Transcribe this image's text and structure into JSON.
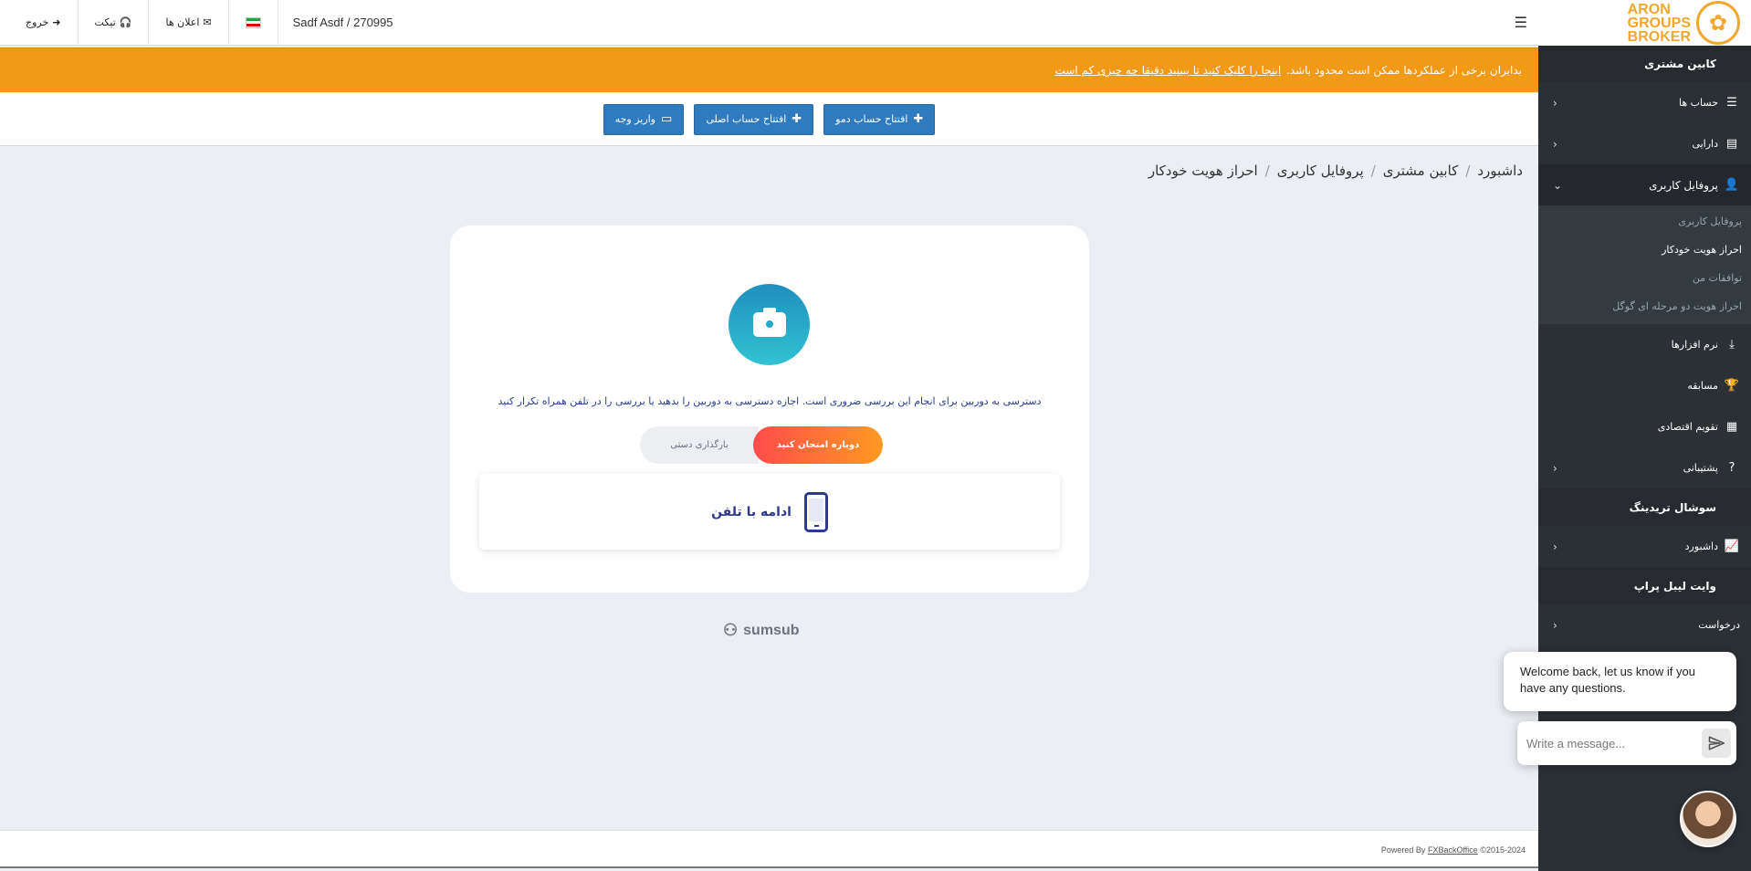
{
  "topbar": {
    "logout_label": "خروج",
    "ticket_label": "تیکت",
    "notifications_label": "اعلان ها",
    "user_label": "Sadf Asdf / 270995"
  },
  "warning": {
    "text": "بدایران برخی از عملکردها ممکن است محدود باشد.",
    "link_text": "اینجا را کلیک کنید تا ببینید دقیقا چه چیزی کم است"
  },
  "actions": {
    "demo_account": "افتتاح حساب دمو",
    "real_account": "افتتاح حساب اصلی",
    "deposit": "واریز وجه"
  },
  "breadcrumb": [
    "داشبورد",
    "کابین مشتری",
    "پروفایل کاربری",
    "احراز هویت خودکار"
  ],
  "verification": {
    "camera_message": "دسترسی به دوربین برای انجام این بررسی ضروری است. اجازه دسترسی به دوربین را بدهید یا بررسی را در تلفن همراه تکرار کنید",
    "retry_label": "دوباره امتحان کنید",
    "manual_upload_label": "بارگذاری دستی",
    "continue_phone_label": "ادامه با تلفن"
  },
  "sumsub_label": "sumsub",
  "footer": {
    "powered_prefix": "Powered By",
    "powered_link": "FXBackOffice",
    "copyright": "©2015-2024"
  },
  "sidebar": {
    "logo_lines": [
      "ARON",
      "GROUPS",
      "BROKER"
    ],
    "section_client": "کابین مشتری",
    "items": [
      {
        "label": "حساب ها",
        "icon": "list-icon"
      },
      {
        "label": "دارایی",
        "icon": "wallet-icon"
      },
      {
        "label": "پروفایل کاربری",
        "icon": "user-icon"
      }
    ],
    "profile_sub": [
      "پروفایل کاربری",
      "احراز هویت خودکار",
      "توافقات من",
      "احراز هویت دو مرحله ای گوگل"
    ],
    "items2": [
      {
        "label": "نرم افزارها",
        "icon": "download-icon"
      },
      {
        "label": "مسابقه",
        "icon": "trophy-icon"
      },
      {
        "label": "تقویم اقتصادی",
        "icon": "calendar-icon"
      },
      {
        "label": "پشتیبانی",
        "icon": "question-icon"
      }
    ],
    "section_social": "سوشال تریدینگ",
    "social_dashboard": "داشبورد",
    "section_whitelabel": "وایت لیبل پراپ",
    "request_label": "درخواست"
  },
  "chat": {
    "welcome": "Welcome back, let us know if you have any questions.",
    "placeholder": "Write a message..."
  },
  "colors": {
    "warning": "#f29a17",
    "primary_button": "#2f7bbf",
    "sidebar": "#2b3035"
  }
}
